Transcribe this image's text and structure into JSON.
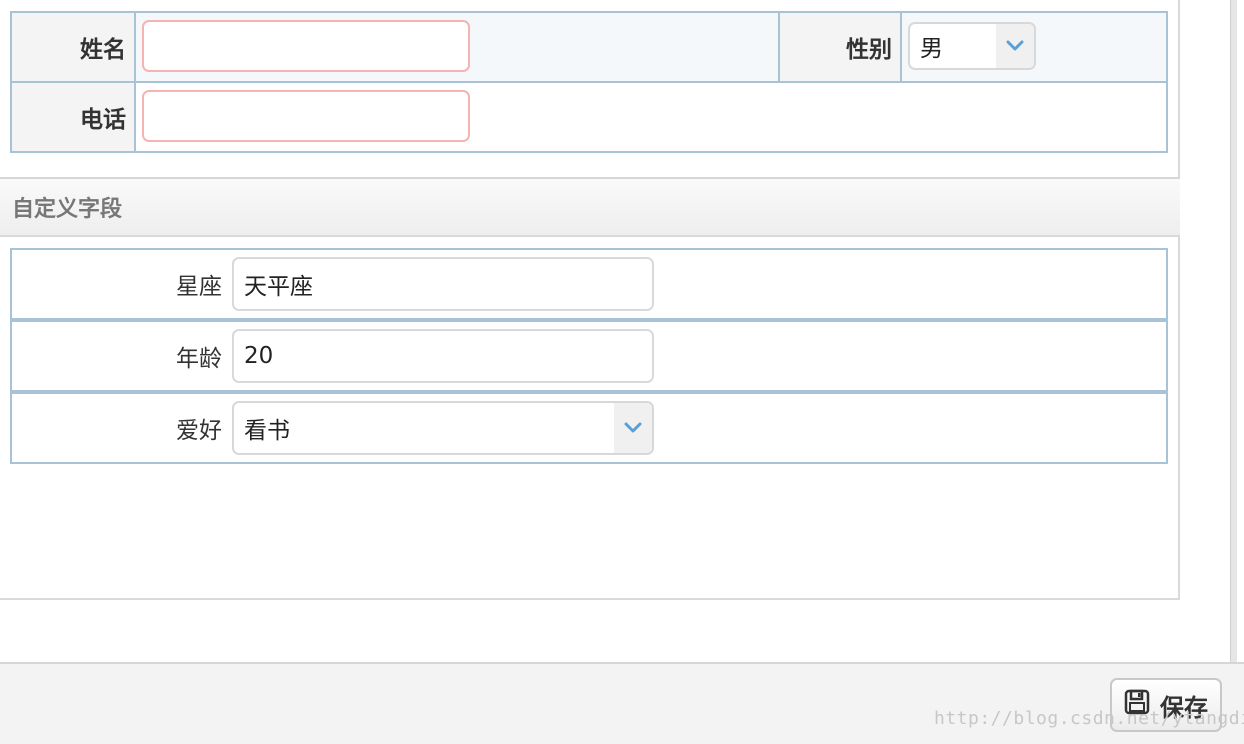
{
  "basic_form": {
    "name_label": "姓名",
    "name_value": "",
    "gender_label": "性别",
    "gender_value": "男",
    "phone_label": "电话",
    "phone_value": ""
  },
  "custom_section": {
    "title": "自定义字段",
    "fields": [
      {
        "label": "星座",
        "value": "天平座",
        "type": "text"
      },
      {
        "label": "年龄",
        "value": "20",
        "type": "text"
      },
      {
        "label": "爱好",
        "value": "看书",
        "type": "select"
      }
    ]
  },
  "footer": {
    "save_label": "保存",
    "watermark": "http://blog.csdn.net/ytangdigl"
  },
  "colors": {
    "table_border": "#a8c3d6",
    "required_border": "#f6b3b3",
    "chevron": "#5aa0d8"
  },
  "icons": {
    "dropdown": "chevron-down-icon",
    "save": "floppy-disk-icon"
  }
}
